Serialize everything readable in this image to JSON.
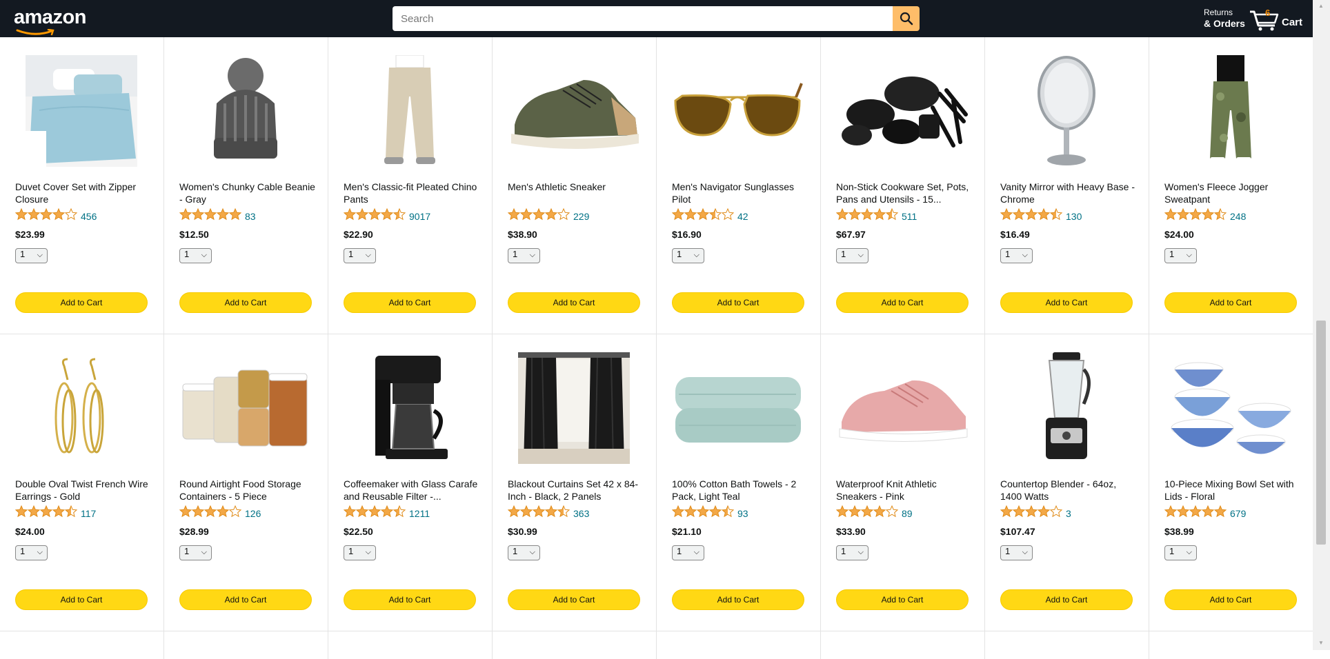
{
  "header": {
    "logo_text": "amazon",
    "search_placeholder": "Search",
    "returns_line1": "Returns",
    "returns_line2": "& Orders",
    "cart_count": "6",
    "cart_label": "Cart"
  },
  "colors": {
    "header_bg": "#131921",
    "search_button": "#febd69",
    "add_button": "#ffd814",
    "star": "#f3a847",
    "link": "#007185"
  },
  "products": [
    {
      "title": "Duvet Cover Set with Zipper Closure",
      "stars": 4,
      "reviews": "456",
      "price": "$23.99",
      "qty": "1",
      "button": "Add to Cart",
      "image": "duvet"
    },
    {
      "title": "Women's Chunky Cable Beanie - Gray",
      "stars": 5,
      "reviews": "83",
      "price": "$12.50",
      "qty": "1",
      "button": "Add to Cart",
      "image": "beanie"
    },
    {
      "title": "Men's Classic-fit Pleated Chino Pants",
      "stars": 4.5,
      "reviews": "9017",
      "price": "$22.90",
      "qty": "1",
      "button": "Add to Cart",
      "image": "pants"
    },
    {
      "title": "Men's Athletic Sneaker",
      "stars": 4,
      "reviews": "229",
      "price": "$38.90",
      "qty": "1",
      "button": "Add to Cart",
      "image": "sneaker"
    },
    {
      "title": "Men's Navigator Sunglasses Pilot",
      "stars": 3.5,
      "reviews": "42",
      "price": "$16.90",
      "qty": "1",
      "button": "Add to Cart",
      "image": "sunglasses"
    },
    {
      "title": "Non-Stick Cookware Set, Pots, Pans and Utensils - 15...",
      "stars": 4.5,
      "reviews": "511",
      "price": "$67.97",
      "qty": "1",
      "button": "Add to Cart",
      "image": "cookware"
    },
    {
      "title": "Vanity Mirror with Heavy Base - Chrome",
      "stars": 4.5,
      "reviews": "130",
      "price": "$16.49",
      "qty": "1",
      "button": "Add to Cart",
      "image": "mirror"
    },
    {
      "title": "Women's Fleece Jogger Sweatpant",
      "stars": 4.5,
      "reviews": "248",
      "price": "$24.00",
      "qty": "1",
      "button": "Add to Cart",
      "image": "jogger"
    },
    {
      "title": "Double Oval Twist French Wire Earrings - Gold",
      "stars": 4.5,
      "reviews": "117",
      "price": "$24.00",
      "qty": "1",
      "button": "Add to Cart",
      "image": "earrings"
    },
    {
      "title": "Round Airtight Food Storage Containers - 5 Piece",
      "stars": 4,
      "reviews": "126",
      "price": "$28.99",
      "qty": "1",
      "button": "Add to Cart",
      "image": "containers"
    },
    {
      "title": "Coffeemaker with Glass Carafe and Reusable Filter -...",
      "stars": 4.5,
      "reviews": "1211",
      "price": "$22.50",
      "qty": "1",
      "button": "Add to Cart",
      "image": "coffeemaker"
    },
    {
      "title": "Blackout Curtains Set 42 x 84-Inch - Black, 2 Panels",
      "stars": 4.5,
      "reviews": "363",
      "price": "$30.99",
      "qty": "1",
      "button": "Add to Cart",
      "image": "curtains"
    },
    {
      "title": "100% Cotton Bath Towels - 2 Pack, Light Teal",
      "stars": 4.5,
      "reviews": "93",
      "price": "$21.10",
      "qty": "1",
      "button": "Add to Cart",
      "image": "towels"
    },
    {
      "title": "Waterproof Knit Athletic Sneakers - Pink",
      "stars": 4,
      "reviews": "89",
      "price": "$33.90",
      "qty": "1",
      "button": "Add to Cart",
      "image": "pink-sneaker"
    },
    {
      "title": "Countertop Blender - 64oz, 1400 Watts",
      "stars": 4,
      "reviews": "3",
      "price": "$107.47",
      "qty": "1",
      "button": "Add to Cart",
      "image": "blender"
    },
    {
      "title": "10-Piece Mixing Bowl Set with Lids - Floral",
      "stars": 5,
      "reviews": "679",
      "price": "$38.99",
      "qty": "1",
      "button": "Add to Cart",
      "image": "bowls"
    }
  ]
}
